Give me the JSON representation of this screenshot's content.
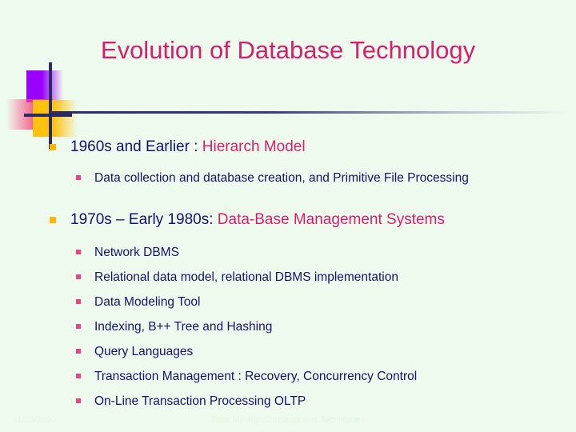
{
  "slide": {
    "title": "Evolution of Database Technology",
    "background_color": "#eefaee",
    "title_color": "#d6206a",
    "body_text_color": "#14146e",
    "accent_color": "#d6206a",
    "bullet1_color": "#ffb600",
    "bullet2_color": "#e8447f",
    "rule_color": "#2b2b63"
  },
  "decoration": {
    "purple_square_color": "#9900ff",
    "pink_square_color": "#f2497f",
    "yellow_square_color": "#ffc20e",
    "cross_line_color": "#2b2b63"
  },
  "sections": [
    {
      "heading_plain": "1960s and Earlier : ",
      "heading_accent": "Hierarch Model",
      "items": [
        "Data collection and   database creation, and Primitive File Processing"
      ]
    },
    {
      "heading_plain": "1970s – Early 1980s: ",
      "heading_accent": "Data-Base Management Systems",
      "items": [
        "Network DBMS",
        "Relational data model, relational DBMS implementation",
        "Data Modeling Tool",
        "Indexing, B++ Tree and Hashing",
        "Query Languages",
        "Transaction Management : Recovery, Concurrency Control",
        "On-Line Transaction Processing OLTP"
      ]
    }
  ],
  "footer": {
    "date": "11/23/2020",
    "center": "Data Mining: Concepts and Techniques"
  }
}
